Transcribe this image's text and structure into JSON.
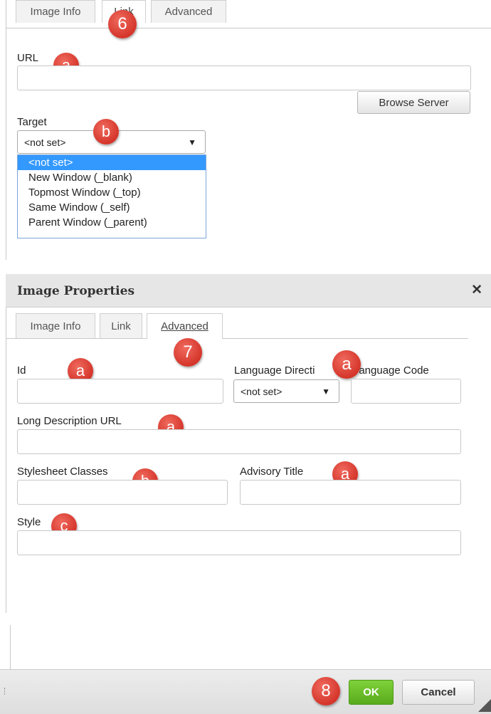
{
  "panel1": {
    "tabs": [
      "Image Info",
      "Link",
      "Advanced"
    ],
    "url_label": "URL",
    "url_value": "",
    "browse_button": "Browse Server",
    "target_label": "Target",
    "target_selected": "<not set>",
    "target_options": [
      "<not set>",
      "New Window (_blank)",
      "Topmost Window (_top)",
      "Same Window (_self)",
      "Parent Window (_parent)"
    ],
    "markers": {
      "tab": "6",
      "url": "a",
      "target": "b"
    }
  },
  "panel2": {
    "dialog_title": "Image Properties",
    "close_glyph": "✕",
    "tabs": [
      "Image Info",
      "Link",
      "Advanced"
    ],
    "id_label": "Id",
    "lang_dir_label": "Language Directi",
    "lang_dir_value": "<not set>",
    "lang_code_label": "Language Code",
    "long_desc_label": "Long Description URL",
    "stylesheet_label": "Stylesheet Classes",
    "advisory_label": "Advisory Title",
    "style_label": "Style",
    "markers": {
      "tab": "7",
      "id": "a",
      "lang": "a",
      "long_desc": "a",
      "stylesheet": "b",
      "advisory": "a",
      "style": "c"
    }
  },
  "footer": {
    "ok_label": "OK",
    "cancel_label": "Cancel",
    "marker": "8"
  },
  "colors": {
    "marker": "#d5352a",
    "ok_green": "#6cc128",
    "title_bar": "#e6e6e6",
    "selected_option": "#3399ff"
  }
}
